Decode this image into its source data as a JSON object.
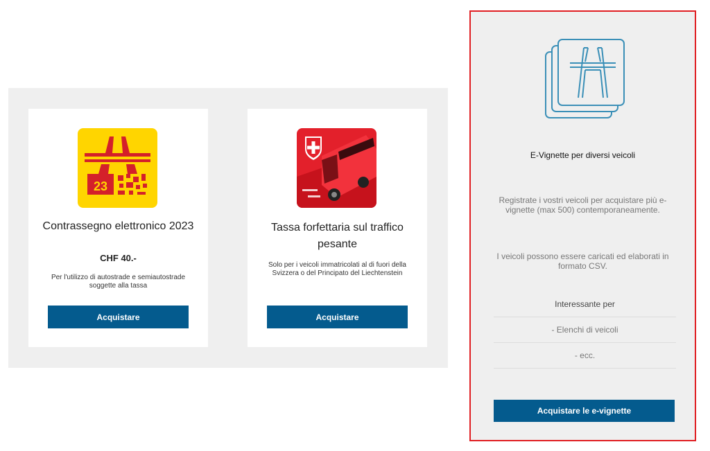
{
  "cards": [
    {
      "title": "Contrassegno elettronico 2023",
      "price": "CHF 40.-",
      "description": "Per l'utilizzo di autostrade e semiautostrade soggette alla tassa",
      "button_label": "Acquistare",
      "image_text": "23"
    },
    {
      "title": "Tassa forfettaria sul traffico pesante",
      "description": "Solo per i veicoli immatricolati al di fuori della Svizzera o del Principato del Liechtenstein",
      "button_label": "Acquistare"
    }
  ],
  "evignette": {
    "title": "E-Vignette per diversi veicoli",
    "text1": "Registrate i vostri veicoli per acquistare più e-vignette (max 500) contemporaneamente.",
    "text2": "I veicoli possono essere caricati ed elaborati in formato CSV.",
    "interest_heading": "Interessante per",
    "interest_items": [
      "- Elenchi di veicoli",
      "- ecc."
    ],
    "button_label": "Acquistare le e-vignette"
  },
  "colors": {
    "button_blue": "#045b8e",
    "highlight_red": "#e01e22",
    "vignette_yellow": "#ffd500",
    "vignette_red": "#d4202a",
    "truck_red": "#e3202b",
    "icon_blue": "#3a8fb7"
  },
  "icons": [
    "vignette-2023-image",
    "heavy-traffic-truck-image",
    "motorway-cards-icon",
    "swiss-cross-icon"
  ]
}
